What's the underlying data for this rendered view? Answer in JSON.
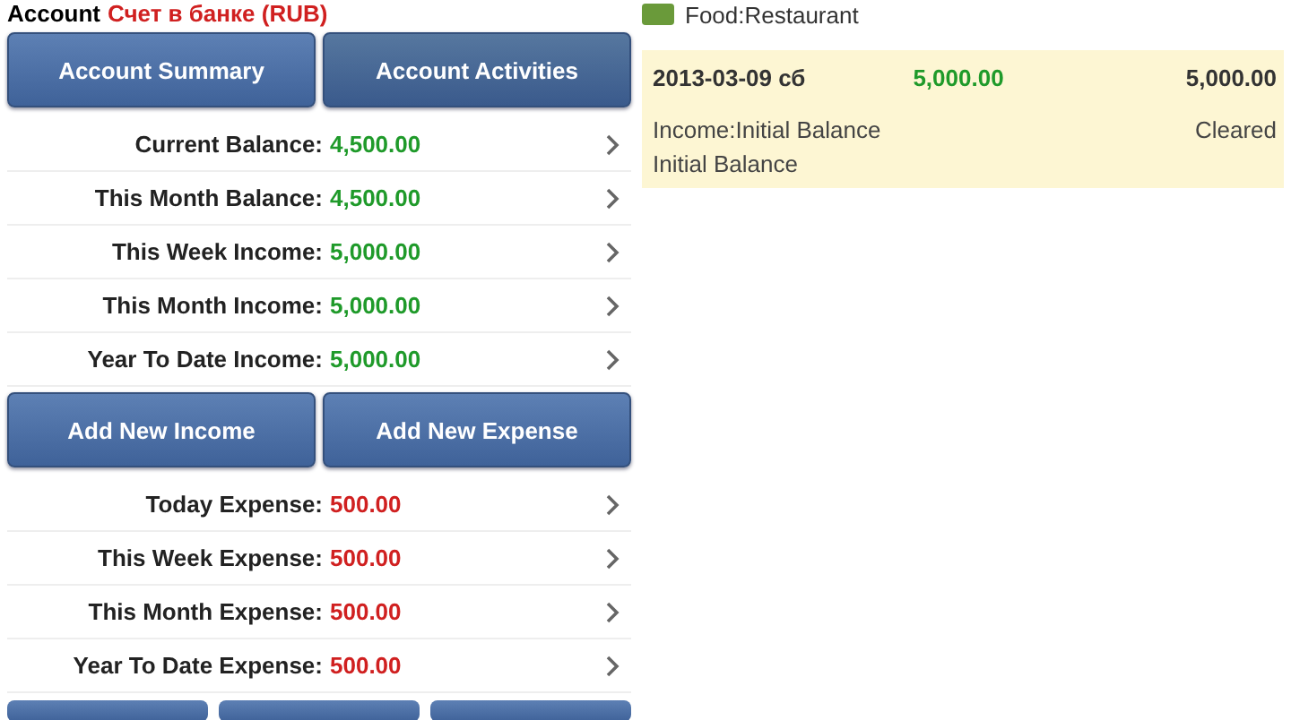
{
  "header": {
    "label": "Account",
    "account_name": "Счет в банке (RUB)"
  },
  "tabs": [
    {
      "label": "Account Summary",
      "selected": true
    },
    {
      "label": "Account Activities",
      "selected": false
    }
  ],
  "income_rows": [
    {
      "label": "Current Balance:",
      "value": "4,500.00"
    },
    {
      "label": "This Month Balance:",
      "value": "4,500.00"
    },
    {
      "label": "This Week Income:",
      "value": "5,000.00"
    },
    {
      "label": "This Month Income:",
      "value": "5,000.00"
    },
    {
      "label": "Year To Date Income:",
      "value": "5,000.00"
    }
  ],
  "actions": [
    "Add New Income",
    "Add New Expense"
  ],
  "expense_rows": [
    {
      "label": "Today Expense:",
      "value": "500.00"
    },
    {
      "label": "This Week Expense:",
      "value": "500.00"
    },
    {
      "label": "This Month Expense:",
      "value": "500.00"
    },
    {
      "label": "Year To Date Expense:",
      "value": "500.00"
    }
  ],
  "category": "Food:Restaurant",
  "transaction": {
    "date": "2013-03-09 сб",
    "amount": "5,000.00",
    "balance": "5,000.00",
    "category": "Income:Initial Balance",
    "status": "Cleared",
    "memo": "Initial Balance"
  }
}
